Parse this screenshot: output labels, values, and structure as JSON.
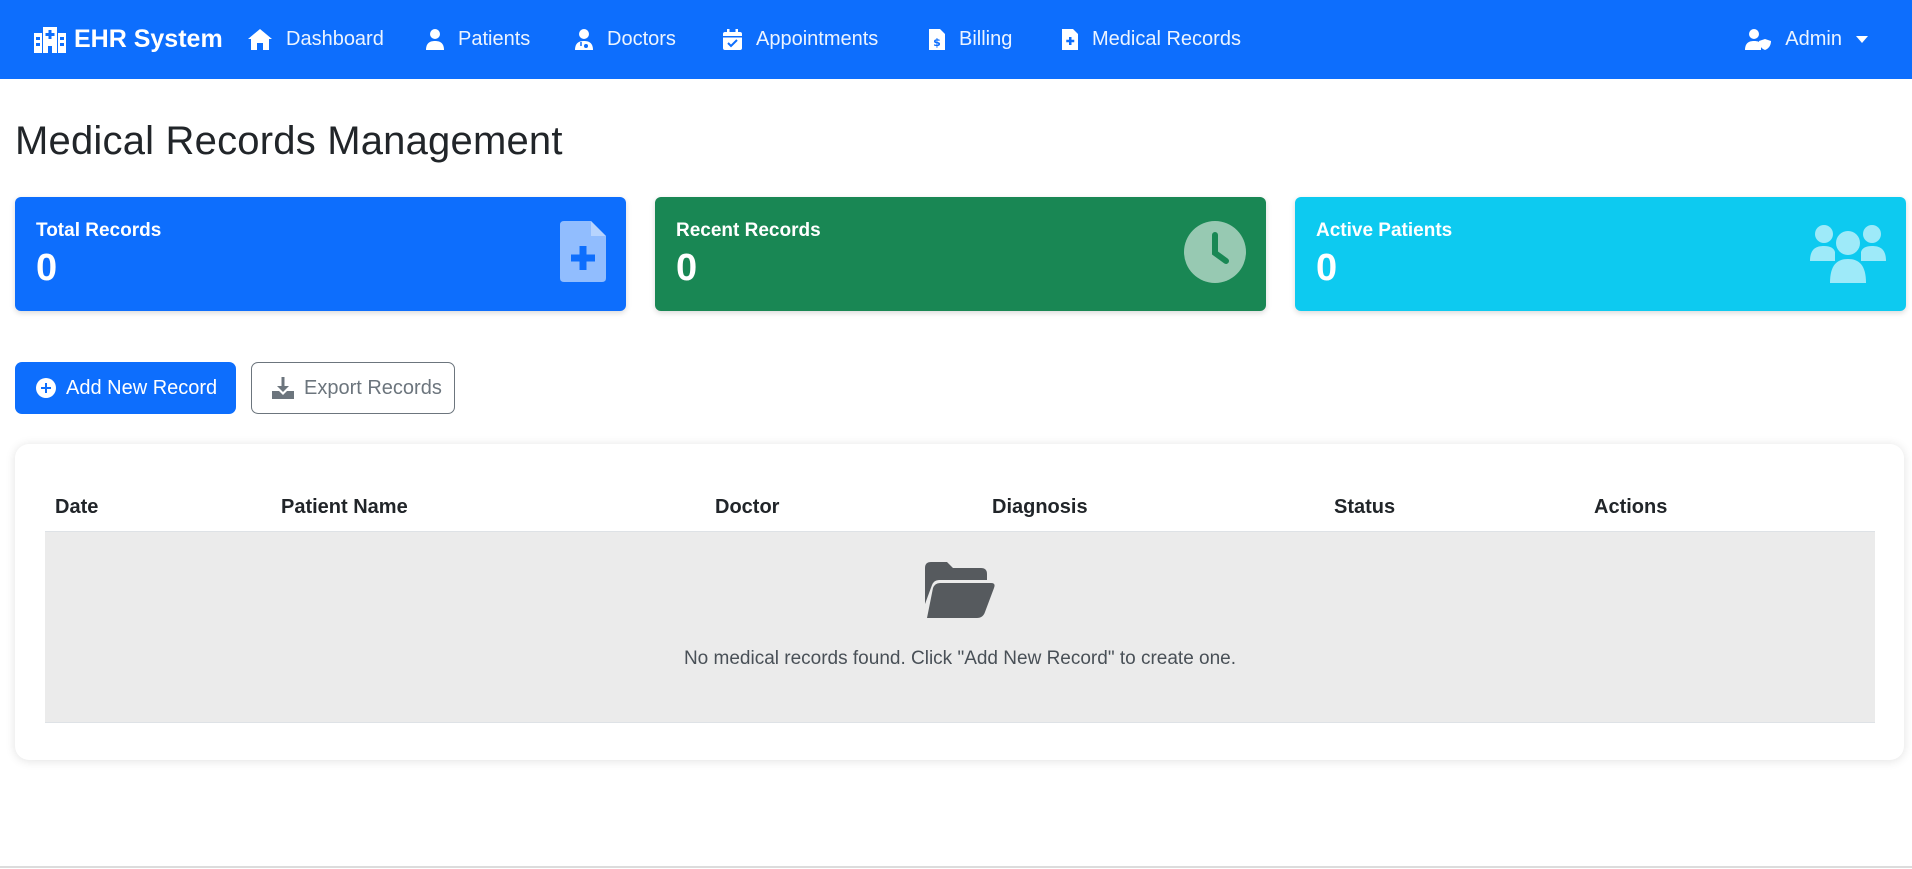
{
  "nav": {
    "brand": "EHR System",
    "items": [
      {
        "label": "Dashboard",
        "icon": "home-icon"
      },
      {
        "label": "Patients",
        "icon": "user-icon"
      },
      {
        "label": "Doctors",
        "icon": "doctor-icon"
      },
      {
        "label": "Appointments",
        "icon": "calendar-check-icon"
      },
      {
        "label": "Billing",
        "icon": "invoice-dollar-icon"
      },
      {
        "label": "Medical Records",
        "icon": "file-medical-icon"
      }
    ],
    "user": "Admin"
  },
  "page": {
    "title": "Medical Records Management"
  },
  "stats": [
    {
      "label": "Total Records",
      "value": "0",
      "icon": "file-medical-icon",
      "color": "#0d6efd"
    },
    {
      "label": "Recent Records",
      "value": "0",
      "icon": "clock-icon",
      "color": "#198754"
    },
    {
      "label": "Active Patients",
      "value": "0",
      "icon": "users-icon",
      "color": "#0dcaf0"
    }
  ],
  "actions": {
    "add_label": "Add New Record",
    "export_label": "Export Records"
  },
  "table": {
    "columns": [
      "Date",
      "Patient Name",
      "Doctor",
      "Diagnosis",
      "Status",
      "Actions"
    ],
    "empty_message": "No medical records found. Click \"Add New Record\" to create one."
  },
  "colors": {
    "primary": "#0d6efd",
    "success": "#198754",
    "info": "#0dcaf0",
    "secondary": "#6c757d"
  }
}
